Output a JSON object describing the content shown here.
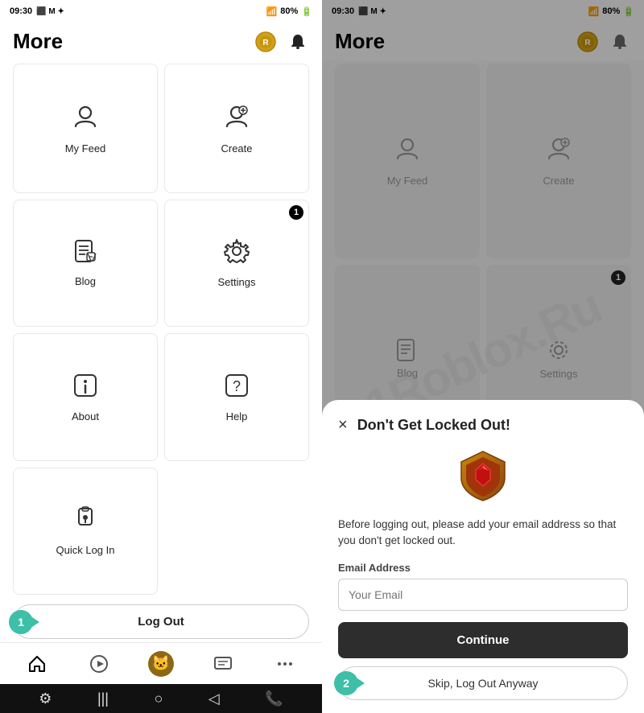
{
  "left_panel": {
    "status_bar": {
      "time": "09:30",
      "icons": "⬛ M ✦",
      "signal": "📶",
      "battery": "80%"
    },
    "header": {
      "title": "More",
      "coin_icon": "🪙",
      "bell_icon": "🔔"
    },
    "menu_items": [
      {
        "id": "my-feed",
        "icon": "👤",
        "label": "My Feed",
        "badge": null
      },
      {
        "id": "create",
        "icon": "✏️",
        "label": "Create",
        "badge": null
      },
      {
        "id": "blog",
        "icon": "📋",
        "label": "Blog",
        "badge": null
      },
      {
        "id": "settings",
        "icon": "⚙️",
        "label": "Settings",
        "badge": "1"
      },
      {
        "id": "about",
        "icon": "ℹ️",
        "label": "About",
        "badge": null
      },
      {
        "id": "help",
        "icon": "❓",
        "label": "Help",
        "badge": null
      },
      {
        "id": "quick-log-in",
        "icon": "🔒",
        "label": "Quick Log In",
        "badge": null
      }
    ],
    "logout_button": {
      "label": "Log Out",
      "step": "1"
    },
    "bottom_nav": [
      {
        "id": "home",
        "icon": "⌂",
        "active": true
      },
      {
        "id": "play",
        "icon": "▶"
      },
      {
        "id": "avatar",
        "icon": "avatar"
      },
      {
        "id": "chat",
        "icon": "☰"
      },
      {
        "id": "more",
        "icon": "•••"
      }
    ]
  },
  "right_panel": {
    "status_bar": {
      "time": "09:30",
      "battery": "80%"
    },
    "header": {
      "title": "More"
    },
    "modal": {
      "title": "Don't Get Locked Out!",
      "close_icon": "×",
      "description": "Before logging out, please add your email address so that you don't get locked out.",
      "email_label": "Email Address",
      "email_placeholder": "Your Email",
      "continue_button": "Continue",
      "skip_button": "Skip, Log Out Anyway",
      "skip_step": "2"
    }
  },
  "watermark": "1Roblox.Ru"
}
